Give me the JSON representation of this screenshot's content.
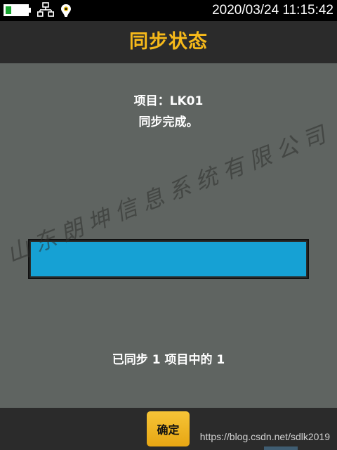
{
  "status_bar": {
    "clock": "2020/03/24  11:15:42",
    "battery_level": 0.3,
    "battery_color": "#17a32f",
    "icons": [
      "battery-icon",
      "network-icon",
      "location-pin-icon"
    ]
  },
  "header": {
    "title": "同步状态",
    "title_color": "#f6b91a"
  },
  "main": {
    "project_line": "项目：LK01",
    "status_line": "同步完成。",
    "progress": {
      "fraction": 1.0,
      "fill_color": "#16a1d4"
    },
    "count_line": "已同步 1 项目中的 1",
    "watermark": "山东朗坤信息系统有限公司"
  },
  "footer": {
    "confirm_label": "确定",
    "blog_watermark": "https://blog.csdn.net/sdlk2019",
    "button_color": "#f6c437"
  }
}
